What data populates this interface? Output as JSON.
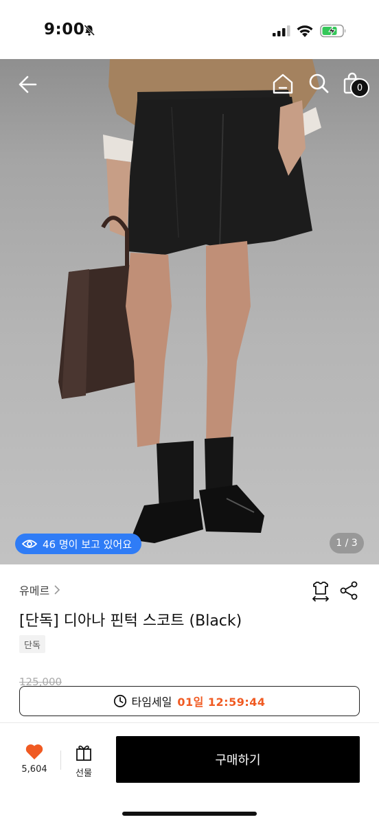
{
  "status_bar": {
    "time": "9:00"
  },
  "header": {
    "cart_count": "0"
  },
  "gallery": {
    "viewers_text": "46 명이 보고 있어요",
    "page_indicator": "1 / 3"
  },
  "product": {
    "brand": "유메르",
    "title": "[단독] 디아나 핀턱 스코트 (Black)",
    "tag": "단독",
    "original_price": "125,000"
  },
  "timesale": {
    "label": "타임세일",
    "countdown": "01일 12:59:44"
  },
  "bottom_bar": {
    "like_count": "5,604",
    "gift_label": "선물",
    "buy_label": "구매하기"
  },
  "colors": {
    "accent": "#f05a22",
    "viewer_pill": "#2f7cf6",
    "like_heart": "#f05a22"
  },
  "icons": [
    "bell-off-icon",
    "signal-icon",
    "wifi-icon",
    "battery-icon",
    "back-arrow-icon",
    "home-icon",
    "search-icon",
    "shopping-bag-icon",
    "eye-icon",
    "chevron-right-icon",
    "fit-size-icon",
    "share-icon",
    "clock-icon",
    "heart-icon",
    "gift-icon"
  ]
}
